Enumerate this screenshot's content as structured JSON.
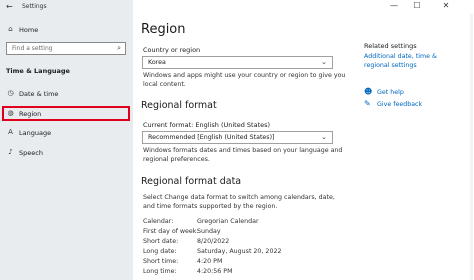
{
  "window": {
    "title": "Settings",
    "back_glyph": "←",
    "minimize_glyph": "—",
    "maximize_glyph": "☐",
    "close_glyph": "✕"
  },
  "sidebar": {
    "home": {
      "label": "Home",
      "icon": "home-icon",
      "glyph": "⌂"
    },
    "search_placeholder": "Find a setting",
    "search_glyph": "⌕",
    "section_title": "Time & Language",
    "items": [
      {
        "label": "Date & time",
        "icon": "calendar-clock-icon",
        "glyph": "◷"
      },
      {
        "label": "Region",
        "icon": "globe-icon",
        "glyph": "◍",
        "selected": true
      },
      {
        "label": "Language",
        "icon": "language-icon",
        "glyph": "A"
      },
      {
        "label": "Speech",
        "icon": "microphone-icon",
        "glyph": "♪"
      }
    ],
    "highlight_color": "#e0001b"
  },
  "main": {
    "title": "Region",
    "country_label": "Country or region",
    "country_value": "Korea",
    "country_desc": "Windows and apps might use your country or region to give you local content.",
    "format_heading": "Regional format",
    "current_format_label": "Current format: English (United States)",
    "format_value": "Recommended [English (United States)]",
    "format_desc": "Windows formats dates and times based on your language and regional preferences.",
    "format_data_heading": "Regional format data",
    "format_data_desc": "Select Change data format to switch among calendars, date, and time formats supported by the region.",
    "format_rows": [
      {
        "key": "Calendar:",
        "value": "Gregorian Calendar"
      },
      {
        "key": "First day of week:",
        "value": "Sunday"
      },
      {
        "key": "Short date:",
        "value": "8/20/2022"
      },
      {
        "key": "Long date:",
        "value": "Saturday, August 20, 2022"
      },
      {
        "key": "Short time:",
        "value": "4:20 PM"
      },
      {
        "key": "Long time:",
        "value": "4:20:56 PM"
      }
    ]
  },
  "related": {
    "title": "Related settings",
    "link1": "Additional date, time & regional settings",
    "help": "Get help",
    "feedback": "Give feedback",
    "accent_color": "#0067c0"
  }
}
